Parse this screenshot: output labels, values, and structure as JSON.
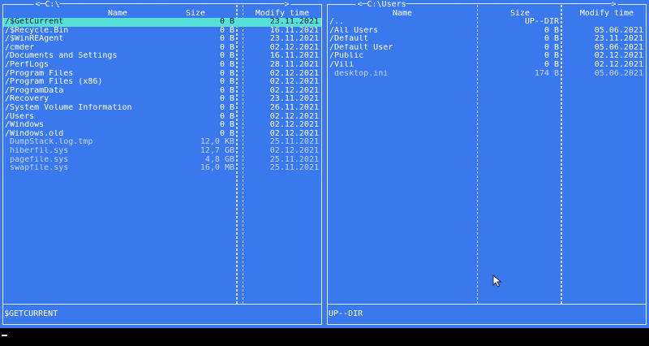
{
  "left": {
    "title": "<─C:\\──────────────────────────────────────────────>",
    "headers": {
      "name": "Name",
      "size": "Size",
      "time": "Modify time"
    },
    "status": "$GETCURRENT",
    "rows": [
      {
        "name": "/$GetCurrent",
        "size": "0 B",
        "time": "23.11.2021"
      },
      {
        "name": "/$Recycle.Bin",
        "size": "0 B",
        "time": "16.11.2021"
      },
      {
        "name": "/$WinREAgent",
        "size": "0 B",
        "time": "23.11.2021"
      },
      {
        "name": "/cmder",
        "size": "0 B",
        "time": "02.12.2021"
      },
      {
        "name": "/Documents and Settings",
        "size": "0 B",
        "time": "16.11.2021"
      },
      {
        "name": "/PerfLogs",
        "size": "0 B",
        "time": "28.11.2021"
      },
      {
        "name": "/Program Files",
        "size": "0 B",
        "time": "02.12.2021"
      },
      {
        "name": "/Program Files (x86)",
        "size": "0 B",
        "time": "02.12.2021"
      },
      {
        "name": "/ProgramData",
        "size": "0 B",
        "time": "02.12.2021"
      },
      {
        "name": "/Recovery",
        "size": "0 B",
        "time": "23.11.2021"
      },
      {
        "name": "/System Volume Information",
        "size": "0 B",
        "time": "26.11.2021"
      },
      {
        "name": "/Users",
        "size": "0 B",
        "time": "02.12.2021"
      },
      {
        "name": "/Windows",
        "size": "0 B",
        "time": "02.12.2021"
      },
      {
        "name": "/Windows.old",
        "size": "0 B",
        "time": "02.12.2021"
      },
      {
        "name": " DumpStack.log.tmp",
        "size": "12,0 KB",
        "time": "25.11.2021"
      },
      {
        "name": " hiberfil.sys",
        "size": "12,7 GB",
        "time": "02.12.2021"
      },
      {
        "name": " pagefile.sys",
        "size": "4,8 GB",
        "time": "25.11.2021"
      },
      {
        "name": " swapfile.sys",
        "size": "16,0 MB",
        "time": "25.11.2021"
      }
    ]
  },
  "right": {
    "title": "<─C:\\Users──────────────────────────────────────────>",
    "headers": {
      "name": "Name",
      "size": "Size",
      "time": "Modify time"
    },
    "status": "UP--DIR",
    "rows": [
      {
        "name": "/..",
        "size": "UP--DIR",
        "time": ""
      },
      {
        "name": "/All Users",
        "size": "0 B",
        "time": "05.06.2021"
      },
      {
        "name": "/Default",
        "size": "0 B",
        "time": "23.11.2021"
      },
      {
        "name": "/Default User",
        "size": "0 B",
        "time": "05.06.2021"
      },
      {
        "name": "/Public",
        "size": "0 B",
        "time": "02.12.2021"
      },
      {
        "name": "/Vili",
        "size": "0 B",
        "time": "02.12.2021"
      },
      {
        "name": " desktop.ini",
        "size": "174 B",
        "time": "05.06.2021"
      }
    ]
  },
  "selected_row": "left.rows.0"
}
